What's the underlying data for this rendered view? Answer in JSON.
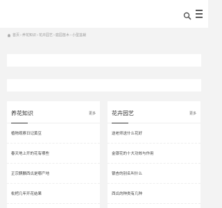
{
  "header": {
    "search_icon": "search-icon",
    "menu_icon": "menu-icon"
  },
  "breadcrumb": {
    "home_icon": "home-icon",
    "items": [
      "首页",
      "养花知识",
      "花卉园艺",
      "庭园苗木",
      "小型盆栽"
    ]
  },
  "sections": [
    {
      "title": "养花知识",
      "more": "更多",
      "items": [
        "植物观察日记黄豆",
        "春天地上开的花有哪些",
        "正宗麒麟西瓜是哪产地",
        "枇杷几年开花结果"
      ]
    },
    {
      "title": "花卉园艺",
      "more": "更多",
      "items": [
        "送老师送什么花好",
        "金银花的十大功效与作用",
        "银杏的别名叫什么",
        "西瓜的种类有几种"
      ]
    }
  ],
  "colors": {
    "page_bg": "#f3f3f3",
    "panel_bg": "#ffffff",
    "muted_text": "#999999"
  }
}
